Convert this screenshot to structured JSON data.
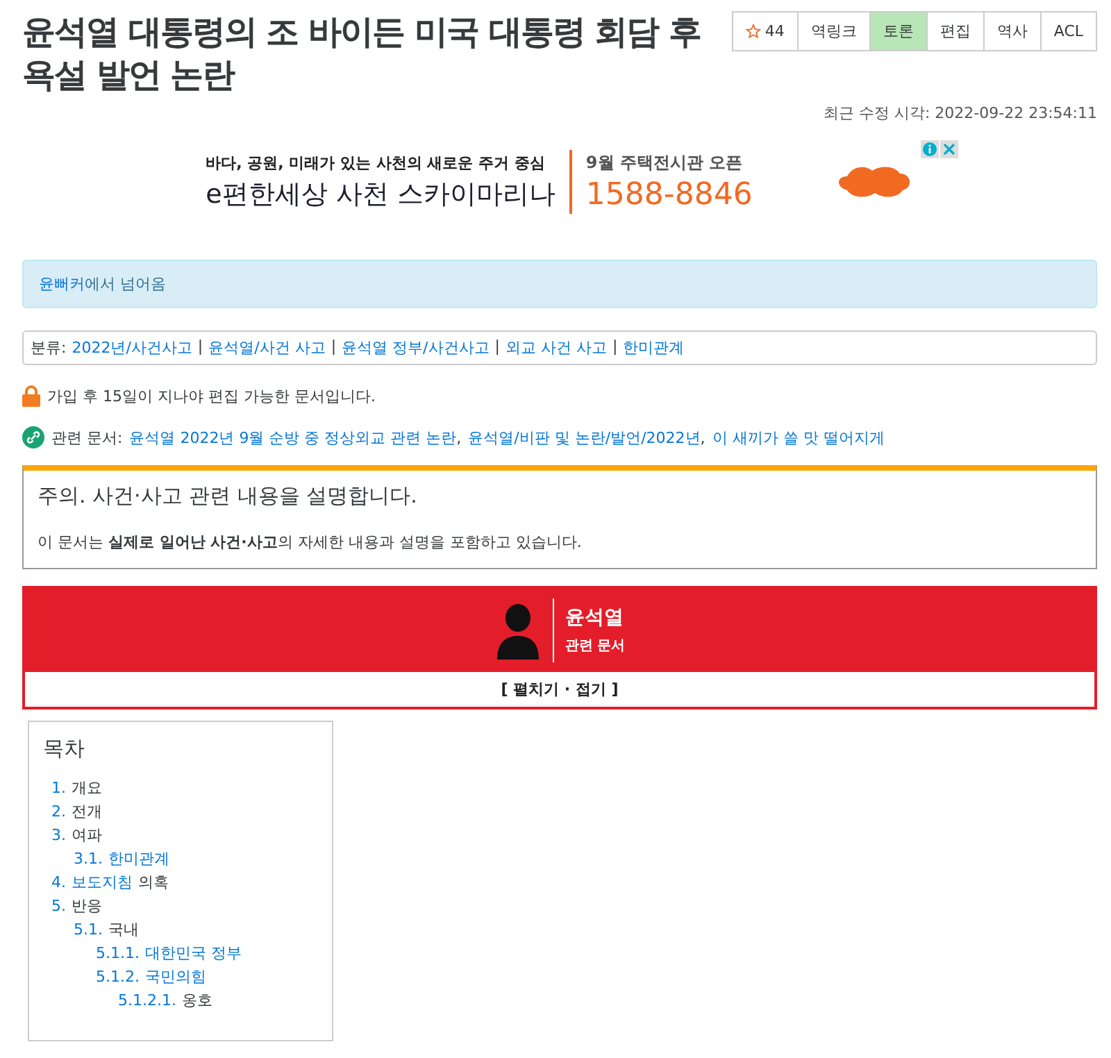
{
  "title": "윤석열 대통령의 조 바이든 미국 대통령 회담 후 욕설 발언 논란",
  "toolbar": [
    {
      "kind": "star",
      "label": "44",
      "selected": false
    },
    {
      "kind": "text",
      "label": "역링크",
      "selected": false
    },
    {
      "kind": "text",
      "label": "토론",
      "selected": true
    },
    {
      "kind": "text",
      "label": "편집",
      "selected": false
    },
    {
      "kind": "text",
      "label": "역사",
      "selected": false
    },
    {
      "kind": "text",
      "label": "ACL",
      "selected": false
    }
  ],
  "last_modified": "최근 수정 시각: 2022-09-22 23:54:11",
  "ad": {
    "tagline": "바다, 공원, 미래가 있는 사천의 새로운 주거 중심",
    "brand": "e편한세상 사천 스카이마리나",
    "event": "9월 주택전시관 오픈",
    "phone": "1588-8846"
  },
  "redirect_notice": {
    "link": "윤뻐커",
    "text": "에서 넘어옴"
  },
  "categories": {
    "label": "분류:",
    "separator": "|",
    "links": [
      "2022년/사건사고",
      "윤석열/사건 사고",
      "윤석열 정부/사건사고",
      "외교 사건 사고",
      "한미관계"
    ]
  },
  "edit_notice": "가입 후 15일이 지나야 편집 가능한 문서입니다.",
  "related": {
    "label": "관련 문서:",
    "separator": ",",
    "links": [
      "윤석열 2022년 9월 순방 중 정상외교 관련 논란",
      "윤석열/비판 및 논란/발언/2022년",
      "이 새끼가 쓸 맛 떨어지게"
    ]
  },
  "caution": {
    "heading": "주의. 사건·사고 관련 내용을 설명합니다.",
    "body": "이 문서는 **실제로 일어난 사건·사고**의 자세한 내용과 설명을 포함하고 있습니다."
  },
  "related_box": {
    "name": "윤석열",
    "subtitle": "관련 문서",
    "toggle": "[ 펼치기 · 접기 ]"
  },
  "toc": {
    "title": "목차",
    "items": [
      {
        "number": "1.",
        "parts": [
          {
            "text": "개요",
            "link": false
          }
        ]
      },
      {
        "number": "2.",
        "parts": [
          {
            "text": "전개",
            "link": false
          }
        ]
      },
      {
        "number": "3.",
        "parts": [
          {
            "text": "여파",
            "link": false
          }
        ],
        "children": [
          {
            "number": "3.1.",
            "parts": [
              {
                "text": "한미관계",
                "link": true
              }
            ]
          }
        ]
      },
      {
        "number": "4.",
        "parts": [
          {
            "text": "보도지침",
            "link": true
          },
          {
            "text": "의혹",
            "link": false
          }
        ]
      },
      {
        "number": "5.",
        "parts": [
          {
            "text": "반응",
            "link": false
          }
        ],
        "children": [
          {
            "number": "5.1.",
            "parts": [
              {
                "text": "국내",
                "link": false
              }
            ],
            "children": [
              {
                "number": "5.1.1.",
                "parts": [
                  {
                    "text": "대한민국 정부",
                    "link": true
                  }
                ]
              },
              {
                "number": "5.1.2.",
                "parts": [
                  {
                    "text": "국민의힘",
                    "link": true
                  }
                ],
                "children": [
                  {
                    "number": "5.1.2.1.",
                    "parts": [
                      {
                        "text": "옹호",
                        "link": false
                      }
                    ]
                  }
                ]
              }
            ]
          }
        ]
      }
    ]
  }
}
